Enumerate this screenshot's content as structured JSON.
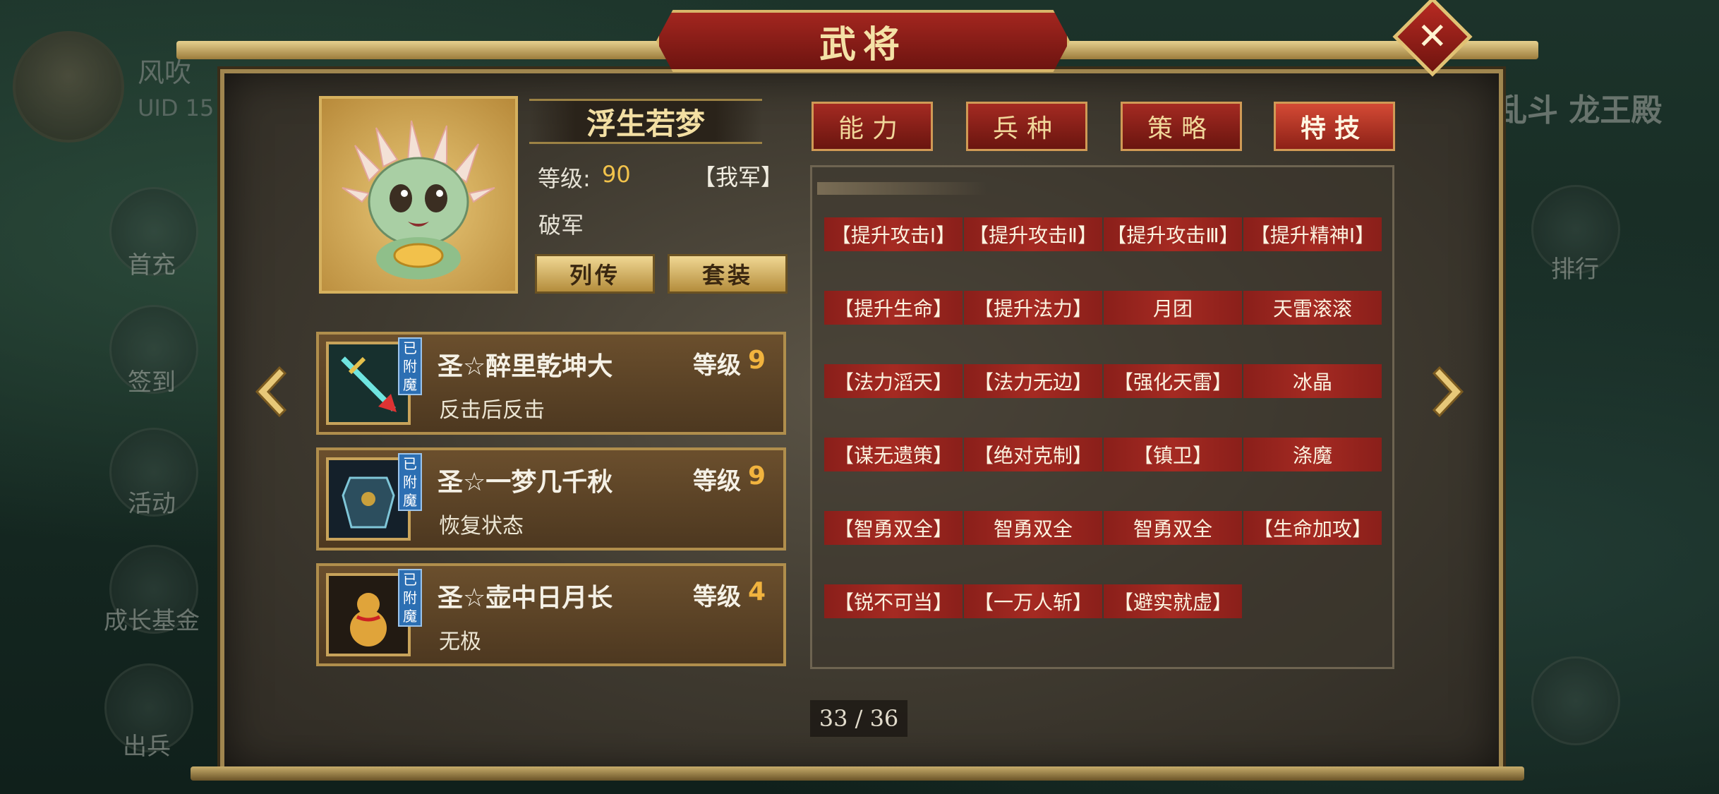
{
  "background": {
    "player_name": "风吹",
    "uid_label": "UID  15",
    "event_title": "乱斗 龙王殿",
    "side_menu": [
      "首充",
      "签到",
      "活动",
      "成长基金",
      "出兵"
    ],
    "right_menu": [
      "排行"
    ]
  },
  "dialog": {
    "title": "武将",
    "close_label": "✕"
  },
  "general": {
    "name": "浮生若梦",
    "level_label": "等级:",
    "level_value": "90",
    "camp": "【我军】",
    "faction": "破军",
    "bio_button": "列传",
    "set_button": "套装"
  },
  "equipment": [
    {
      "name": "圣☆醉里乾坤大",
      "level_label": "等级",
      "level": "9",
      "desc": "反击后反击",
      "tag": "已附魔",
      "icon": "sword-icon"
    },
    {
      "name": "圣☆一梦几千秋",
      "level_label": "等级",
      "level": "9",
      "desc": "恢复状态",
      "tag": "已附魔",
      "icon": "armor-icon"
    },
    {
      "name": "圣☆壶中日月长",
      "level_label": "等级",
      "level": "4",
      "desc": "无极",
      "tag": "已附魔",
      "icon": "gourd-icon"
    }
  ],
  "tabs": [
    {
      "label": "能力",
      "active": false
    },
    {
      "label": "兵种",
      "active": false
    },
    {
      "label": "策略",
      "active": false
    },
    {
      "label": "特技",
      "active": true
    }
  ],
  "skills": [
    [
      "【提升攻击Ⅰ】",
      "【提升攻击Ⅱ】",
      "【提升攻击Ⅲ】",
      "【提升精神Ⅰ】"
    ],
    [
      "【提升生命】",
      "【提升法力】",
      "月团",
      "天雷滚滚"
    ],
    [
      "【法力滔天】",
      "【法力无边】",
      "【强化天雷】",
      "冰晶"
    ],
    [
      "【谋无遗策】",
      "【绝对克制】",
      "【镇卫】",
      "涤魔"
    ],
    [
      "【智勇双全】",
      "智勇双全",
      "智勇双全",
      "【生命加攻】"
    ],
    [
      "【锐不可当】",
      "【一万人斩】",
      "【避实就虚】"
    ]
  ],
  "pagination": "33 / 36",
  "colors": {
    "accent_red": "#a42a22",
    "gold": "#d6b15e",
    "level_orange": "#f1b33e"
  }
}
